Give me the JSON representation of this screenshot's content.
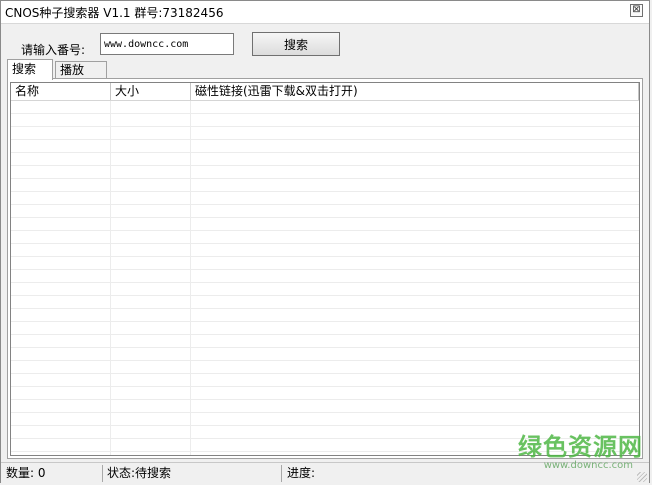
{
  "window": {
    "title": "CNOS种子搜索器 V1.1 群号:73182456",
    "close_glyph": "⊠"
  },
  "search": {
    "label": "请输入番号:",
    "value": "www.downcc.com",
    "button_label": "搜索"
  },
  "tabs": [
    {
      "label": "搜索",
      "active": true
    },
    {
      "label": "播放",
      "active": false
    }
  ],
  "table": {
    "columns": [
      "名称",
      "大小",
      "磁性链接(迅雷下载&双击打开)"
    ],
    "rows": []
  },
  "status": {
    "count": "数量: 0",
    "state": "状态:待搜索",
    "progress": "进度:"
  },
  "watermark": {
    "brand": "绿色资源网",
    "site": "www.downcc.com"
  }
}
